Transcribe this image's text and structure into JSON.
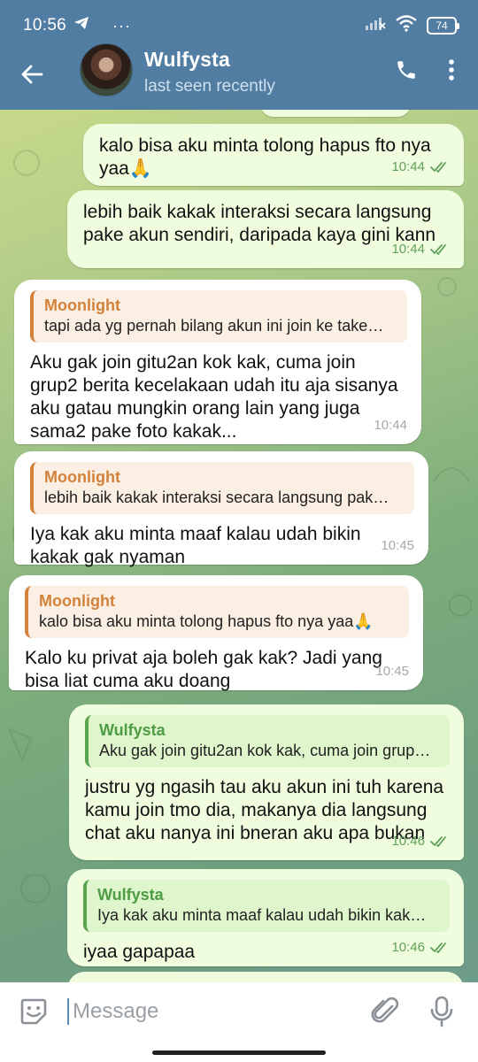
{
  "status_bar": {
    "time": "10:56",
    "dots": "···",
    "battery": "74"
  },
  "chat_header": {
    "name": "Wulfysta",
    "status": "last seen recently"
  },
  "messages": [
    {
      "direction": "out",
      "text": "kalo bisa aku minta tolong hapus fto nya yaa🙏",
      "time": "10:44",
      "read": true
    },
    {
      "direction": "out",
      "text": "lebih baik kakak interaksi secara langsung pake akun sendiri, daripada kaya gini kann",
      "time": "10:44",
      "read": true
    },
    {
      "direction": "in",
      "reply_name": "Moonlight",
      "reply_text": "tapi ada yg pernah bilang akun ini join ke take…",
      "text": "Aku gak join gitu2an kok kak, cuma join grup2 berita kecelakaan udah itu aja sisanya aku gatau mungkin orang lain yang juga sama2 pake foto kakak...",
      "time": "10:44"
    },
    {
      "direction": "in",
      "reply_name": "Moonlight",
      "reply_text": "lebih baik kakak interaksi secara langsung pak…",
      "text": "Iya kak aku minta maaf kalau udah bikin kakak gak nyaman",
      "time": "10:45"
    },
    {
      "direction": "in",
      "reply_name": "Moonlight",
      "reply_text": "kalo bisa aku minta tolong hapus fto nya yaa🙏",
      "text": "Kalo ku privat aja boleh gak kak? Jadi yang bisa liat cuma aku doang",
      "time": "10:45"
    },
    {
      "direction": "out",
      "reply_name": "Wulfysta",
      "reply_text": "Aku gak join gitu2an kok kak, cuma join grup…",
      "text": "justru yg ngasih tau aku akun ini tuh karena kamu join tmo dia, makanya dia langsung chat aku nanya ini bneran aku apa bukan",
      "time": "10:46",
      "read": true
    },
    {
      "direction": "out",
      "reply_name": "Wulfysta",
      "reply_text": "Iya kak aku minta maaf kalau udah bikin kak…",
      "text": "iyaa gapapaa",
      "time": "10:46",
      "read": true
    }
  ],
  "input": {
    "placeholder": "Message"
  },
  "colors": {
    "header": "#527da3",
    "outgoing_bubble": "#effdde",
    "incoming_bubble": "#ffffff",
    "reply_in_accent": "#d3823b",
    "reply_out_accent": "#5aa44d",
    "check_color": "#5fa15a"
  },
  "icons": {
    "back": "arrow-left-icon",
    "call": "phone-icon",
    "menu": "more-vertical-icon",
    "emoji": "sticker-icon",
    "attach": "paperclip-icon",
    "mic": "microphone-icon",
    "telegram": "send-arrow-icon",
    "wifi": "wifi-icon",
    "signal": "signal-icon"
  }
}
